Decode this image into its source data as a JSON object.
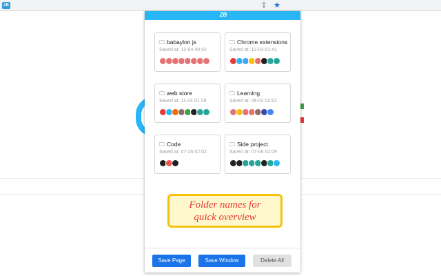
{
  "toolbar": {
    "share_icon": "share-icon",
    "star_icon": "bookmark-star-icon",
    "extension_badge": "ZB"
  },
  "popup": {
    "logo": "ZB"
  },
  "folders": [
    {
      "name": "babaylon js",
      "saved": "Saved at: 12-04 00:42"
    },
    {
      "name": "Chrome extensions",
      "saved": "Saved at: 12-03 01:41"
    },
    {
      "name": "web store",
      "saved": "Saved at: 11-24 01:29"
    },
    {
      "name": "Learning",
      "saved": "Saved at: 08-02 02:52"
    },
    {
      "name": "Code",
      "saved": "Saved at: 07-26 02:02"
    },
    {
      "name": "Side project",
      "saved": "Saved at: 07-06 02:09"
    }
  ],
  "callout": {
    "line1": "Folder names for",
    "line2": "quick overview"
  },
  "footer": {
    "save_page": "Save Page",
    "save_window": "Save Window",
    "delete_all": "Delete All"
  },
  "colors": {
    "accent": "#29b6f6",
    "button_blue": "#1a73e8",
    "callout_border": "#f4c20d",
    "callout_text": "#e53935"
  }
}
